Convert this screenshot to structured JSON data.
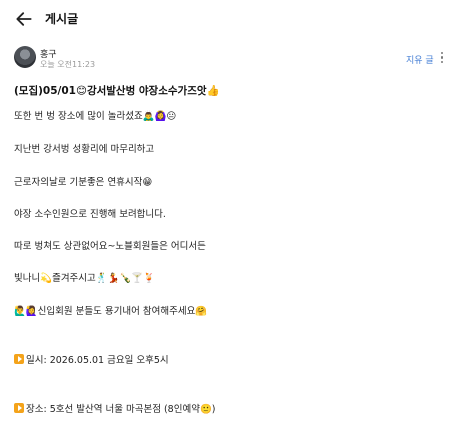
{
  "header": {
    "title": "게시글"
  },
  "author": {
    "name": "홍구",
    "time": "오늘 오전11:23",
    "delete_label": "지유 글"
  },
  "post": {
    "title": "(모집)05/01",
    "title_suffix": "강서발산벙 야장소수가즈앗",
    "lines": [
      {
        "text": "또한 번 벙 장소에 많이 놀라셨죠",
        "emoji": "🙇‍♂️🙆‍♀️😐"
      },
      {
        "text": "지난번 강서벙 성황리에 마무리하고",
        "emoji": ""
      },
      {
        "text": "근로자의날로 기분좋은 연휴시작",
        "emoji": "😁"
      },
      {
        "text": "야장 소수인원으로 진행해 보려합니다.",
        "emoji": ""
      },
      {
        "text": "따로 벙쳐도 상관없어요~노블회원들은 어디서든",
        "emoji": ""
      },
      {
        "text": "빛나니",
        "emoji": "💫",
        "text2": "즐겨주시고",
        "emoji2": "🕺💃🍾🍸🍹"
      },
      {
        "lead_emoji": "🙋‍♂️🙋‍♀️",
        "text": "신입회원 분들도 용기내어 참여해주세요",
        "emoji": "🤗"
      }
    ],
    "date_line": "일시: 2026.05.01 금요일 오후5시",
    "place_line": "장소: 5호선 발산역 너울 마곡본점 (8인예약",
    "place_end": ")"
  },
  "icons": {
    "back": "arrow-left-icon",
    "more": "more-vertical-icon",
    "play": "play-button-icon"
  },
  "colors": {
    "accent": "#4a82d6",
    "play": "#f4a31a"
  }
}
